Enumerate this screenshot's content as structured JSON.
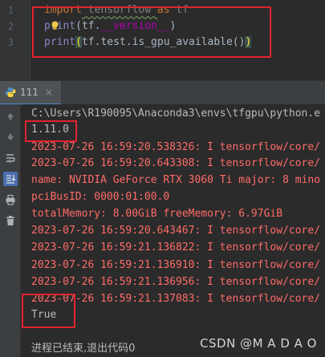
{
  "editor": {
    "line_numbers": [
      "1",
      "2",
      "3"
    ],
    "lines": [
      {
        "kw": "import",
        "mid": " tensorflow ",
        "kw2": "as",
        "tail": " tf"
      },
      {
        "fn": "print",
        "open": "(tf.",
        "dunder": "__version__",
        "close": ")"
      },
      {
        "fn": "print",
        "open": "(",
        "body": "tf.test.is_gpu_available()",
        "close": ")"
      }
    ]
  },
  "run_panel": {
    "tab_label": "111",
    "tab_close": "×"
  },
  "toolbar_icons": [
    "arrow-up-icon",
    "arrow-down-icon",
    "wrap-icon",
    "scroll-to-end-icon",
    "print-icon",
    "trash-icon"
  ],
  "console": {
    "lines": [
      {
        "text": "C:\\Users\\R190095\\Anaconda3\\envs\\tfgpu\\python.e",
        "type": "normal"
      },
      {
        "text": "1.11.0",
        "type": "normal"
      },
      {
        "text": "2023-07-26 16:59:20.538326: I tensorflow/core/",
        "type": "err"
      },
      {
        "text": "2023-07-26 16:59:20.643308: I tensorflow/core/",
        "type": "err"
      },
      {
        "text": "name: NVIDIA GeForce RTX 3060 Ti major: 8 mino",
        "type": "err"
      },
      {
        "text": "pciBusID: 0000:01:00.0",
        "type": "err"
      },
      {
        "text": "totalMemory: 8.00GiB freeMemory: 6.97GiB",
        "type": "err"
      },
      {
        "text": "2023-07-26 16:59:20.643467: I tensorflow/core/",
        "type": "err"
      },
      {
        "text": "2023-07-26 16:59:21.136822: I tensorflow/core/",
        "type": "err"
      },
      {
        "text": "2023-07-26 16:59:21.136910: I tensorflow/core/",
        "type": "err"
      },
      {
        "text": "2023-07-26 16:59:21.136956: I tensorflow/core/",
        "type": "err"
      },
      {
        "text": "2023-07-26 16:59:21.137083: I tensorflow/core/",
        "type": "err"
      },
      {
        "text": "True",
        "type": "normal"
      },
      {
        "text": "",
        "type": "normal"
      },
      {
        "text": "进程已结束,退出代码0",
        "type": "exit"
      }
    ]
  },
  "watermark": "CSDN @M A D A O",
  "colors": {
    "highlight_box": "#e0232e",
    "error_text": "#ff6b68",
    "keyword": "#cc7832",
    "dunder": "#b200b2"
  }
}
